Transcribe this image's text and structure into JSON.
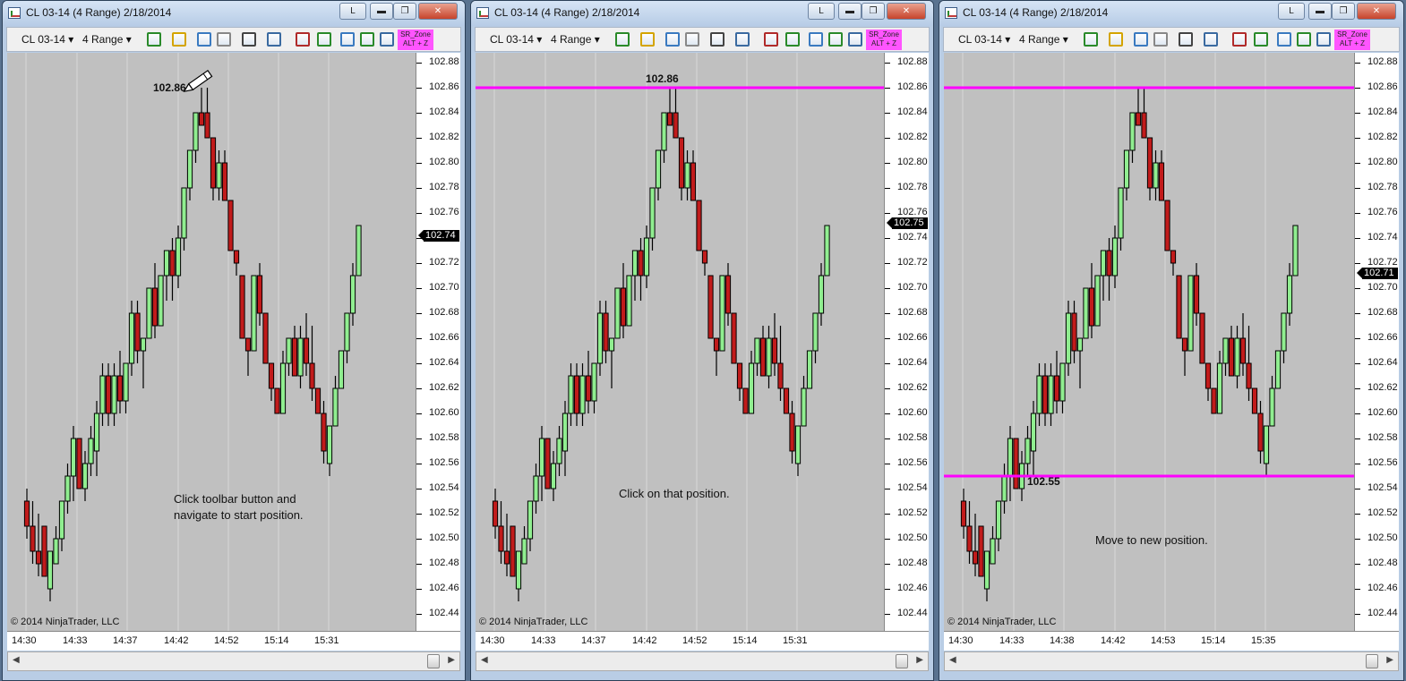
{
  "windows": [
    {
      "title": "CL 03-14 (4 Range)  2/18/2014",
      "toolbar": {
        "instrument": "CL 03-14",
        "period": "4 Range",
        "sr_zone": "SR_Zone",
        "sr_zone_shortcut": "ALT + Z"
      },
      "price_label": "102.86",
      "current_price": "102.74",
      "x_labels": [
        "14:30",
        "14:33",
        "14:37",
        "14:42",
        "14:52",
        "15:14",
        "15:31"
      ],
      "copyright": "© 2014 NinjaTrader, LLC",
      "note_line1": "Click toolbar button and",
      "note_line2": "navigate to start position."
    },
    {
      "title": "CL 03-14 (4 Range)  2/18/2014",
      "toolbar": {
        "instrument": "CL 03-14",
        "period": "4 Range",
        "sr_zone": "SR_Zone",
        "sr_zone_shortcut": "ALT + Z"
      },
      "price_label": "102.86",
      "current_price": "102.75",
      "x_labels": [
        "14:30",
        "14:33",
        "14:37",
        "14:42",
        "14:52",
        "15:14",
        "15:31"
      ],
      "copyright": "© 2014 NinjaTrader, LLC",
      "note_line1": "Click on that position.",
      "note_line2": ""
    },
    {
      "title": "CL 03-14 (4 Range)  2/18/2014",
      "toolbar": {
        "instrument": "CL 03-14",
        "period": "4 Range",
        "sr_zone": "SR_Zone",
        "sr_zone_shortcut": "ALT + Z"
      },
      "price_label": "102.55",
      "current_price": "102.71",
      "x_labels": [
        "14:30",
        "14:33",
        "14:38",
        "14:42",
        "14:53",
        "15:14",
        "15:35"
      ],
      "copyright": "© 2014 NinjaTrader, LLC",
      "note_line1": "Move to new position.",
      "note_line2": ""
    }
  ],
  "y_ticks": [
    "102.88",
    "102.86",
    "102.84",
    "102.82",
    "102.80",
    "102.78",
    "102.76",
    "102.74",
    "102.72",
    "102.70",
    "102.68",
    "102.66",
    "102.64",
    "102.62",
    "102.60",
    "102.58",
    "102.56",
    "102.54",
    "102.52",
    "102.50",
    "102.48",
    "102.46",
    "102.44"
  ],
  "window_buttons": {
    "lock": "L"
  },
  "colors": {
    "plot_bg": "#c0c0c0",
    "up_candle": "#90ee90",
    "down_candle": "#c11b1b",
    "sr_line": "#ff00ff",
    "price_badge": "#000000"
  },
  "chart_data": {
    "type": "candlestick",
    "ylim": [
      102.43,
      102.89
    ],
    "candles": [
      [
        102.53,
        102.54,
        102.5,
        102.51
      ],
      [
        102.51,
        102.53,
        102.48,
        102.49
      ],
      [
        102.49,
        102.52,
        102.47,
        102.48
      ],
      [
        102.51,
        102.51,
        102.47,
        102.47
      ],
      [
        102.46,
        102.49,
        102.45,
        102.49
      ],
      [
        102.48,
        102.51,
        102.48,
        102.5
      ],
      [
        102.5,
        102.53,
        102.49,
        102.53
      ],
      [
        102.53,
        102.56,
        102.52,
        102.55
      ],
      [
        102.55,
        102.59,
        102.53,
        102.58
      ],
      [
        102.58,
        102.58,
        102.54,
        102.54
      ],
      [
        102.54,
        102.57,
        102.53,
        102.56
      ],
      [
        102.56,
        102.59,
        102.55,
        102.58
      ],
      [
        102.57,
        102.61,
        102.55,
        102.6
      ],
      [
        102.6,
        102.64,
        102.59,
        102.63
      ],
      [
        102.63,
        102.64,
        102.59,
        102.6
      ],
      [
        102.6,
        102.64,
        102.59,
        102.63
      ],
      [
        102.63,
        102.65,
        102.6,
        102.61
      ],
      [
        102.61,
        102.64,
        102.6,
        102.64
      ],
      [
        102.64,
        102.69,
        102.63,
        102.68
      ],
      [
        102.68,
        102.69,
        102.64,
        102.65
      ],
      [
        102.65,
        102.66,
        102.62,
        102.66
      ],
      [
        102.66,
        102.7,
        102.66,
        102.7
      ],
      [
        102.7,
        102.72,
        102.66,
        102.67
      ],
      [
        102.67,
        102.71,
        102.67,
        102.71
      ],
      [
        102.71,
        102.73,
        102.69,
        102.73
      ],
      [
        102.73,
        102.74,
        102.69,
        102.71
      ],
      [
        102.71,
        102.75,
        102.7,
        102.74
      ],
      [
        102.74,
        102.78,
        102.73,
        102.78
      ],
      [
        102.78,
        102.81,
        102.77,
        102.81
      ],
      [
        102.81,
        102.84,
        102.8,
        102.84
      ],
      [
        102.84,
        102.86,
        102.83,
        102.83
      ],
      [
        102.84,
        102.86,
        102.82,
        102.82
      ],
      [
        102.82,
        102.82,
        102.77,
        102.78
      ],
      [
        102.78,
        102.81,
        102.77,
        102.8
      ],
      [
        102.8,
        102.81,
        102.77,
        102.77
      ],
      [
        102.77,
        102.77,
        102.73,
        102.73
      ],
      [
        102.73,
        102.73,
        102.71,
        102.72
      ],
      [
        102.71,
        102.71,
        102.66,
        102.66
      ],
      [
        102.66,
        102.66,
        102.63,
        102.65
      ],
      [
        102.65,
        102.71,
        102.65,
        102.71
      ],
      [
        102.71,
        102.72,
        102.67,
        102.68
      ],
      [
        102.68,
        102.68,
        102.64,
        102.64
      ],
      [
        102.64,
        102.64,
        102.61,
        102.62
      ],
      [
        102.62,
        102.62,
        102.6,
        102.6
      ],
      [
        102.6,
        102.65,
        102.6,
        102.64
      ],
      [
        102.64,
        102.66,
        102.63,
        102.66
      ],
      [
        102.66,
        102.67,
        102.63,
        102.63
      ],
      [
        102.63,
        102.67,
        102.62,
        102.66
      ],
      [
        102.66,
        102.68,
        102.63,
        102.64
      ],
      [
        102.64,
        102.67,
        102.61,
        102.62
      ],
      [
        102.62,
        102.62,
        102.6,
        102.6
      ],
      [
        102.6,
        102.61,
        102.56,
        102.57
      ],
      [
        102.56,
        102.59,
        102.55,
        102.59
      ],
      [
        102.59,
        102.63,
        102.59,
        102.62
      ],
      [
        102.62,
        102.65,
        102.62,
        102.65
      ],
      [
        102.65,
        102.68,
        102.64,
        102.68
      ],
      [
        102.68,
        102.72,
        102.67,
        102.71
      ],
      [
        102.71,
        102.75,
        102.71,
        102.75
      ]
    ]
  }
}
